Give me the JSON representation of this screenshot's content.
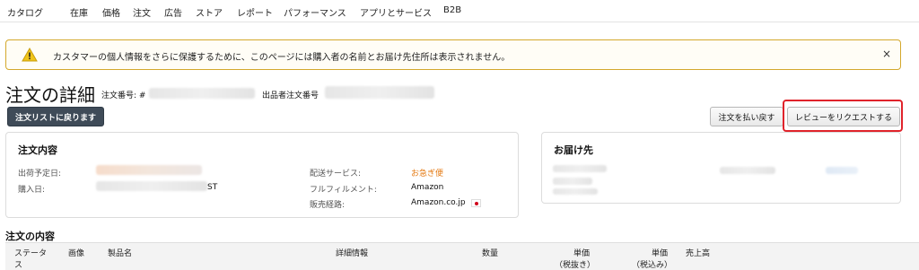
{
  "nav": {
    "items": [
      "カタログ",
      "在庫",
      "価格",
      "注文",
      "広告",
      "ストア",
      "レポート",
      "パフォーマンス",
      "アプリとサービス",
      "B2B"
    ]
  },
  "alert": {
    "icon": "warning-icon",
    "message": "カスタマーの個人情報をさらに保護するために、このページには購入者の名前とお届け先住所は表示されません。",
    "close": "×"
  },
  "header": {
    "title": "注文の詳細",
    "order_no_label": "注文番号: #",
    "seller_order_no_label": "出品者注文番号"
  },
  "buttons": {
    "back": "注文リストに戻ります",
    "refund": "注文を払い戻す",
    "request_review": "レビューをリクエストする"
  },
  "order_summary": {
    "title": "注文内容",
    "ship_date_label": "出荷予定日:",
    "purchase_date_label": "購入日:",
    "purchase_date_suffix": "ST",
    "shipping_service_label": "配送サービス:",
    "shipping_service_value": "お急ぎ便",
    "fulfillment_label": "フルフィルメント:",
    "fulfillment_value": "Amazon",
    "sales_channel_label": "販売経路:",
    "sales_channel_value": "Amazon.co.jp"
  },
  "shipping": {
    "title": "お届け先"
  },
  "items_table": {
    "title": "注文の内容",
    "columns": {
      "status_1": "ステータ",
      "status_2": "ス",
      "image": "画像",
      "product": "製品名",
      "details": "詳細情報",
      "qty": "数量",
      "unit_price": "単価",
      "tax_excl": "（税抜き）",
      "unit_price_2": "単価",
      "tax_incl": "（税込み）",
      "subtotal": "売上高"
    }
  },
  "colors": {
    "accent_orange": "#e47911",
    "highlight_red": "#e0232b",
    "warning_yellow": "#d4a82c"
  }
}
